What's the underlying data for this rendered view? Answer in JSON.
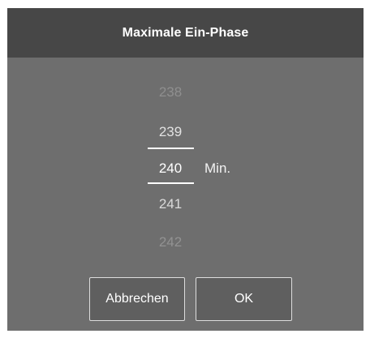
{
  "dialog": {
    "title": "Maximale Ein-Phase",
    "picker": {
      "values": [
        "238",
        "239",
        "240",
        "241",
        "242"
      ],
      "selected": "240",
      "unit": "Min."
    },
    "buttons": {
      "cancel": "Abbrechen",
      "ok": "OK"
    }
  }
}
